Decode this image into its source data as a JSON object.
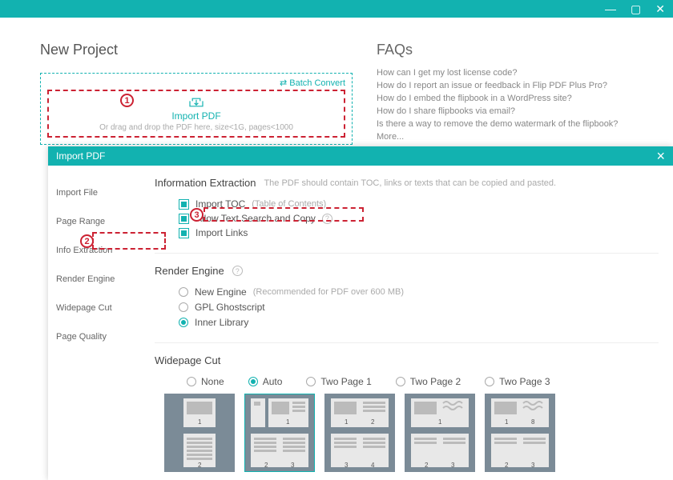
{
  "titlebar": {
    "min": "—",
    "max": "▢",
    "close": "✕"
  },
  "backPage": {
    "newProject": "New Project",
    "batchConvert": "Batch Convert",
    "importPDF": "Import PDF",
    "dropHint": "Or drag and drop the PDF here, size<1G, pages<1000",
    "faqsTitle": "FAQs",
    "faqs": [
      "How can I get my lost license code?",
      "How do I report an issue or feedback in Flip PDF Plus Pro?",
      "How do I embed the flipbook in a WordPress site?",
      "How do I share flipbooks via email?",
      "Is there a way to remove the demo watermark of the flipbook?",
      "More..."
    ]
  },
  "modal": {
    "title": "Import PDF",
    "sidebar": [
      "Import File",
      "Page Range",
      "Info Extraction",
      "Render Engine",
      "Widepage Cut",
      "Page Quality"
    ],
    "infoExt": {
      "title": "Information Extraction",
      "hint": "The PDF should contain TOC, links or texts that can be copied and pasted.",
      "importToc": "Import TOC",
      "tocSub": "(Table of Contents)",
      "allowText": "Allow Text Search and Copy",
      "importLinks": "Import Links"
    },
    "render": {
      "title": "Render Engine",
      "newEngine": "New Engine",
      "newSub": "(Recommended for PDF over 600 MB)",
      "gpl": "GPL Ghostscript",
      "inner": "Inner Library"
    },
    "wide": {
      "title": "Widepage Cut",
      "none": "None",
      "auto": "Auto",
      "tp1": "Two Page 1",
      "tp2": "Two Page 2",
      "tp3": "Two Page 3"
    }
  },
  "markers": {
    "m1": "1",
    "m2": "2",
    "m3": "3"
  }
}
